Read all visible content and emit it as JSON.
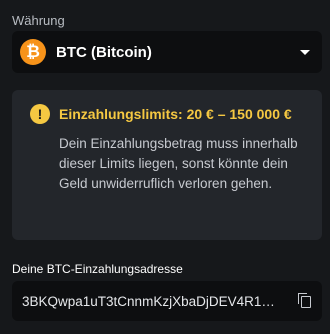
{
  "currency": {
    "label": "Währung",
    "selected": "BTC (Bitcoin)",
    "icon": "bitcoin-icon",
    "icon_glyph": "₿",
    "icon_color": "#f7931a"
  },
  "limits": {
    "icon": "warning-icon",
    "icon_glyph": "!",
    "accent_color": "#f5c842",
    "title": "Einzahlungslimits: 20 € – 150 000 €",
    "text": "Dein Einzahlungsbetrag muss innerhalb dieser Limits liegen, sonst könnte dein Geld unwiderruflich verloren gehen."
  },
  "address": {
    "label": "Deine BTC-Einzahlungsadresse",
    "value": "3BKQwpa1uT3tCnnmKzjXbaDjDEV4R1…",
    "copy_icon": "copy-icon"
  }
}
